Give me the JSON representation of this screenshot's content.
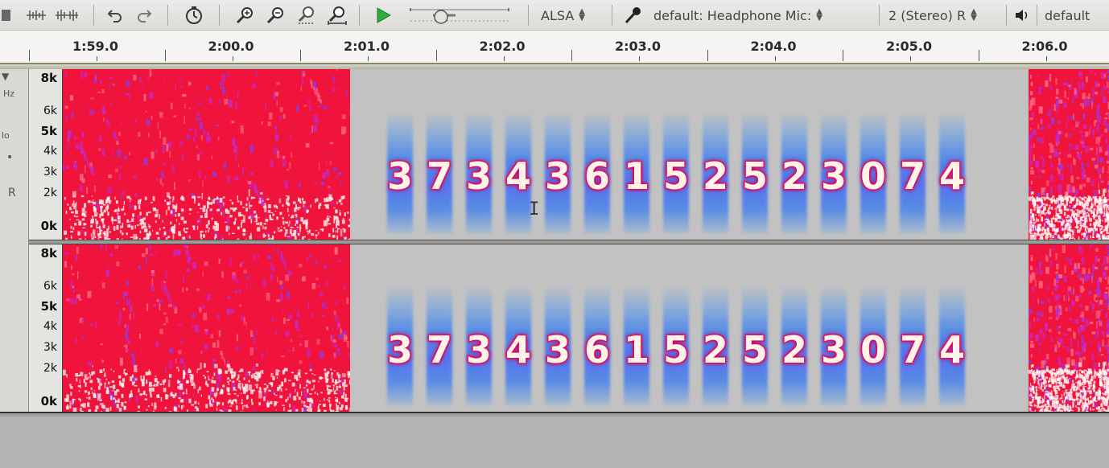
{
  "toolbar": {
    "host": "ALSA",
    "recording_device": "default: Headphone Mic:",
    "channels": "2 (Stereo) R",
    "playback_device": "default",
    "icons": [
      "multi-tool-icon",
      "trim-icon",
      "silence-icon",
      "undo-icon",
      "redo-icon",
      "sync-lock-icon",
      "zoom-in-icon",
      "zoom-out-icon",
      "fit-selection-icon",
      "fit-project-icon",
      "play-icon",
      "speed-slider",
      "mic-icon",
      "speaker-icon"
    ]
  },
  "ruler": {
    "labels": [
      "1:59.0",
      "2:00.0",
      "2:01.0",
      "2:02.0",
      "2:03.0",
      "2:04.0",
      "2:05.0",
      "2:06.0"
    ]
  },
  "track": {
    "control_labels": [
      "▼",
      "Hz",
      "lo",
      "•",
      "R"
    ],
    "freq_scale": {
      "top": "8k",
      "labels": [
        "6k",
        "5k",
        "4k",
        "3k",
        "2k"
      ],
      "bottom": "0k"
    }
  },
  "spectrogram": {
    "hidden_digits": [
      "3",
      "7",
      "3",
      "4",
      "3",
      "6",
      "1",
      "5",
      "2",
      "5",
      "2",
      "3",
      "0",
      "7",
      "4"
    ],
    "colors": {
      "noise": "#ff1744",
      "digit_glow": "#4a86e8",
      "background": "#c2c2c2"
    }
  }
}
